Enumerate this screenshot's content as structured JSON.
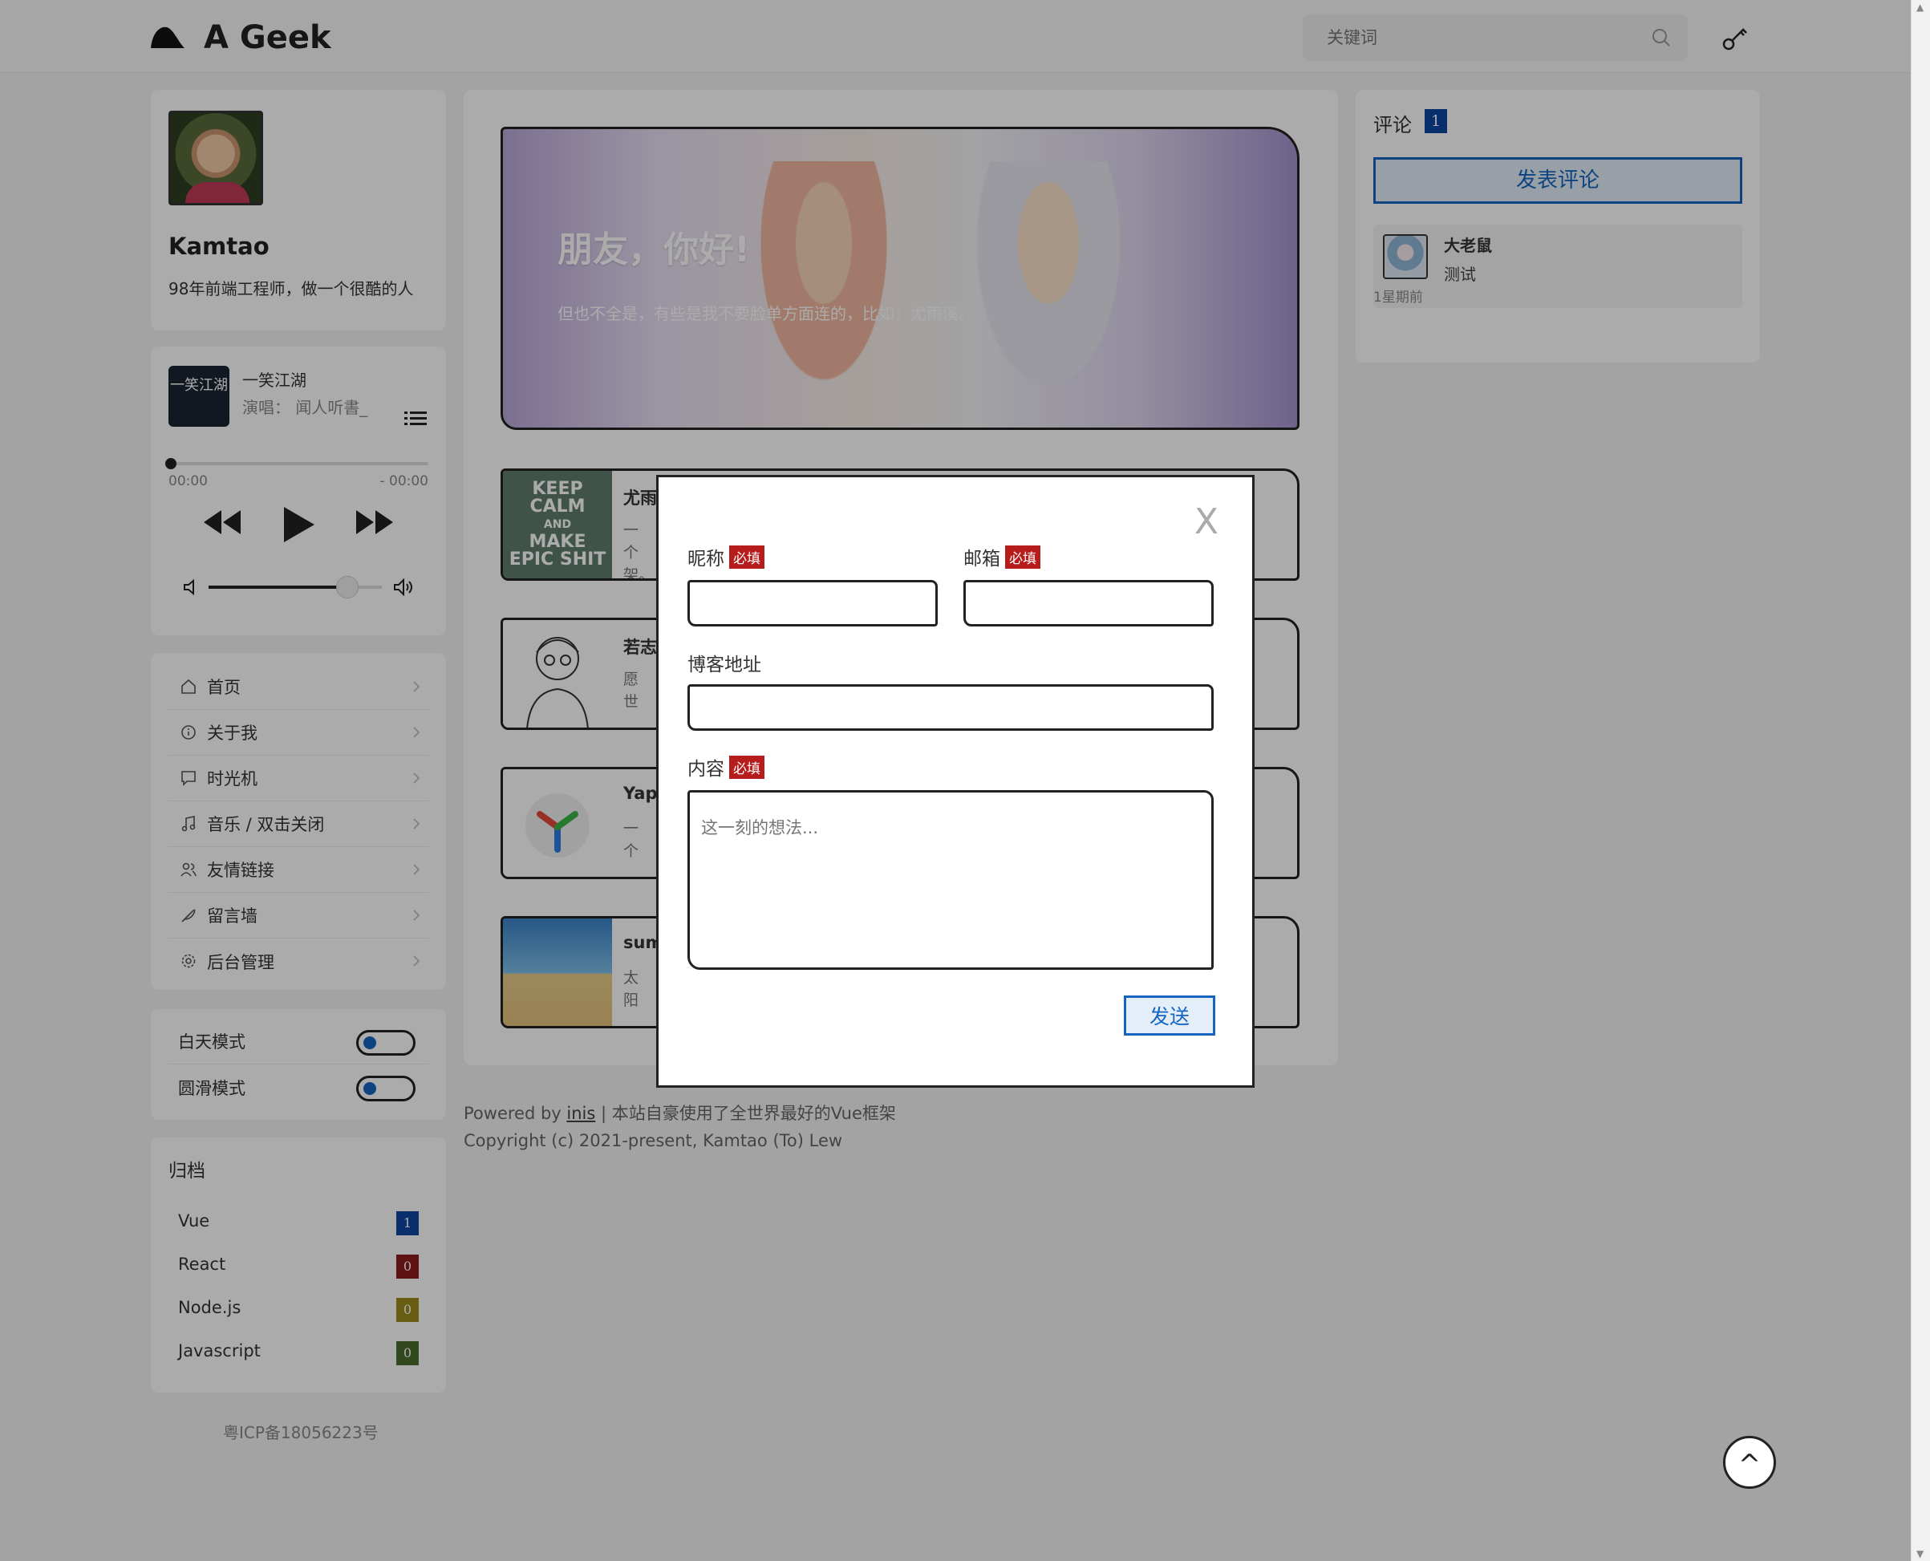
{
  "header": {
    "brand": "A Geek",
    "search_placeholder": "关键词"
  },
  "profile": {
    "name": "Kamtao",
    "bio": "98年前端工程师，做一个很酷的人"
  },
  "player": {
    "cover_text": "一笑江湖",
    "title": "一笑江湖",
    "artist": "演唱：  闻人听書_",
    "time_elapsed": "00:00",
    "time_remaining": "- 00:00",
    "progress": 0,
    "volume": 0.8
  },
  "nav": {
    "items": [
      {
        "label": "首页",
        "icon": "home-icon"
      },
      {
        "label": "关于我",
        "icon": "info-icon"
      },
      {
        "label": "时光机",
        "icon": "chat-icon"
      },
      {
        "label": "音乐 / 双击关闭",
        "icon": "music-icon"
      },
      {
        "label": "友情链接",
        "icon": "users-icon"
      },
      {
        "label": "留言墙",
        "icon": "feather-icon"
      },
      {
        "label": "后台管理",
        "icon": "gear-icon"
      }
    ]
  },
  "modes": {
    "day": "白天模式",
    "smooth": "圆滑模式"
  },
  "archive": {
    "title": "归档",
    "items": [
      {
        "label": "Vue",
        "count": "1",
        "color": "#0d47a1"
      },
      {
        "label": "React",
        "count": "0",
        "color": "#8b1a1a"
      },
      {
        "label": "Node.js",
        "count": "0",
        "color": "#9a8a1c"
      },
      {
        "label": "Javascript",
        "count": "0",
        "color": "#4a6b2c"
      }
    ]
  },
  "icp": "粤ICP备18056223号",
  "banner": {
    "title": "朋友，你好!",
    "subtitle": "但也不全是，有些是我不要脸单方面连的，比如：尤雨溪。"
  },
  "posts": [
    {
      "title": "尤雨",
      "desc": "一个架。",
      "thumb_lines": [
        "KEEP",
        "CALM",
        "AND",
        "MAKE",
        "EPIC SHIT"
      ]
    },
    {
      "title": "若志",
      "desc": "愿世"
    },
    {
      "title": "Yapi",
      "desc": "一个"
    },
    {
      "title": "sum",
      "desc": "太阳"
    }
  ],
  "footer": {
    "powered_prefix": "Powered by ",
    "powered_link": "inis",
    "powered_suffix": " | 本站自豪使用了全世界最好的Vue框架",
    "copyright": "Copyright (c) 2021-present, Kamtao (To) Lew"
  },
  "comments": {
    "title": "评论",
    "count": "1",
    "post_button": "发表评论",
    "items": [
      {
        "name": "大老鼠",
        "text": "测试",
        "time": "1星期前"
      }
    ]
  },
  "modal": {
    "close": "X",
    "nickname_label": "昵称",
    "email_label": "邮箱",
    "required": "必填",
    "blog_label": "博客地址",
    "content_label": "内容",
    "content_placeholder": "这一刻的想法...",
    "send": "发送"
  },
  "back_to_top": "^"
}
